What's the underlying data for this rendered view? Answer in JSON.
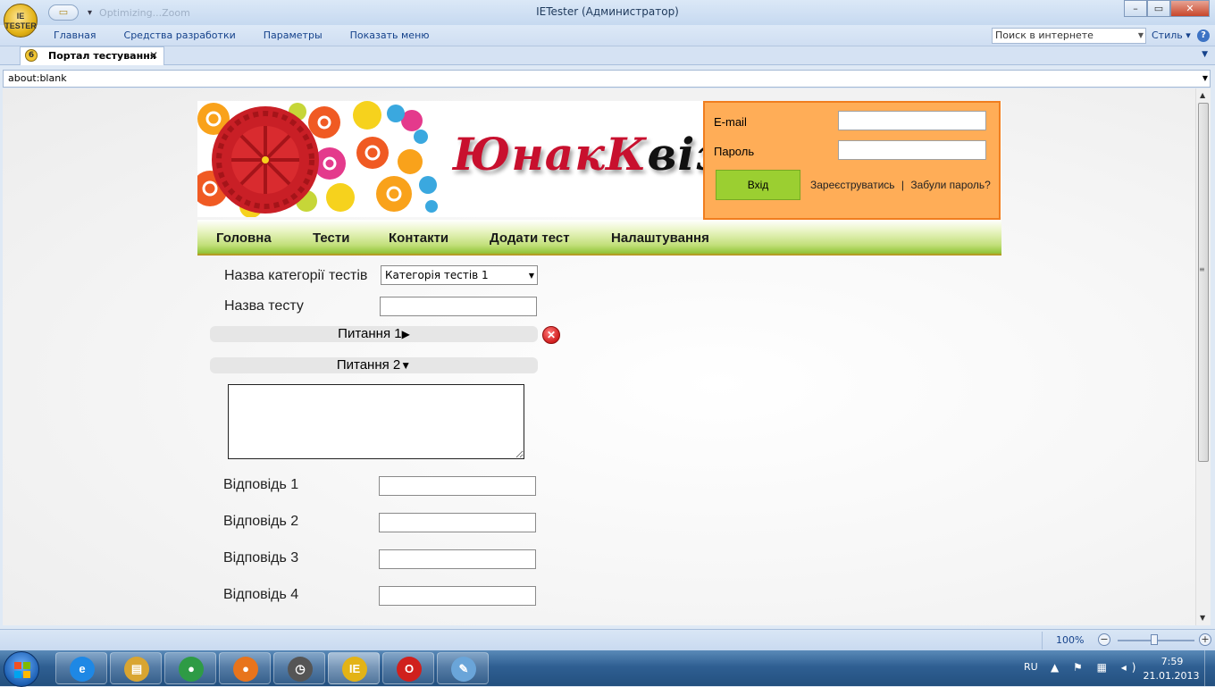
{
  "window": {
    "title": "IETester (Администратор)",
    "qat_faded": "Optimizing...Zoom",
    "minimize": "–",
    "maximize": "▭",
    "close": "✕"
  },
  "ribbon": {
    "menu": [
      "Главная",
      "Средства разработки",
      "Параметры",
      "Показать меню"
    ],
    "search_placeholder": "Поиск в интернете",
    "style_label": "Стиль",
    "help": "?"
  },
  "tab": {
    "badge": "6",
    "label": "Портал тестування",
    "close": "✕"
  },
  "address": {
    "url": "about:blank"
  },
  "site": {
    "brand_part1": "Юнак",
    "brand_part2": "К",
    "brand_part3": "віз",
    "login": {
      "email_label": "E-mail",
      "password_label": "Пароль",
      "email_value": "",
      "password_value": "",
      "submit_label": "Вхід",
      "register_link": "Зареєструватись",
      "separator": "|",
      "forgot_link": "Забули пароль?"
    },
    "nav": [
      "Головна",
      "Тести",
      "Контакти",
      "Додати тест",
      "Налаштування"
    ]
  },
  "form": {
    "category_label": "Назва категорії тестів",
    "category_selected": "Категорія тестів 1",
    "test_name_label": "Назва тесту",
    "test_name_value": "",
    "question1_label": "Питання 1",
    "question1_marker": "▶",
    "question2_label": "Питання 2",
    "question2_marker": "▼",
    "question2_text": "",
    "answers": [
      {
        "label": "Відповідь 1",
        "value": ""
      },
      {
        "label": "Відповідь 2",
        "value": ""
      },
      {
        "label": "Відповідь 3",
        "value": ""
      },
      {
        "label": "Відповідь 4",
        "value": ""
      }
    ],
    "delete_symbol": "✕"
  },
  "statusbar": {
    "zoom": "100%",
    "zoom_out": "−",
    "zoom_in": "+",
    "zoom_slider_level": 0.5
  },
  "taskbar": {
    "apps": [
      {
        "name": "internet-explorer",
        "glyph": "e",
        "color": "#1e88e5"
      },
      {
        "name": "file-explorer",
        "glyph": "▤",
        "color": "#d9a531"
      },
      {
        "name": "chrome",
        "glyph": "●",
        "color": "#2e9b45"
      },
      {
        "name": "firefox",
        "glyph": "●",
        "color": "#e8741c"
      },
      {
        "name": "clock-app",
        "glyph": "◷",
        "color": "#555555"
      },
      {
        "name": "ietester",
        "glyph": "IE",
        "color": "#e3b316"
      },
      {
        "name": "opera",
        "glyph": "O",
        "color": "#d0201d"
      },
      {
        "name": "paint",
        "glyph": "✎",
        "color": "#6aa5d9"
      }
    ],
    "lang": "RU",
    "tray_glyphs": "▲ ⚑ ▦ ◂)",
    "time": "7:59",
    "date": "21.01.2013"
  },
  "colors": {
    "login_panel": "#ffad57",
    "login_border": "#f07e1f",
    "login_button": "#9bcf31",
    "brand_red": "#c8102e",
    "nav_green": "#94c63d",
    "taskbar": "#2f5f92"
  }
}
